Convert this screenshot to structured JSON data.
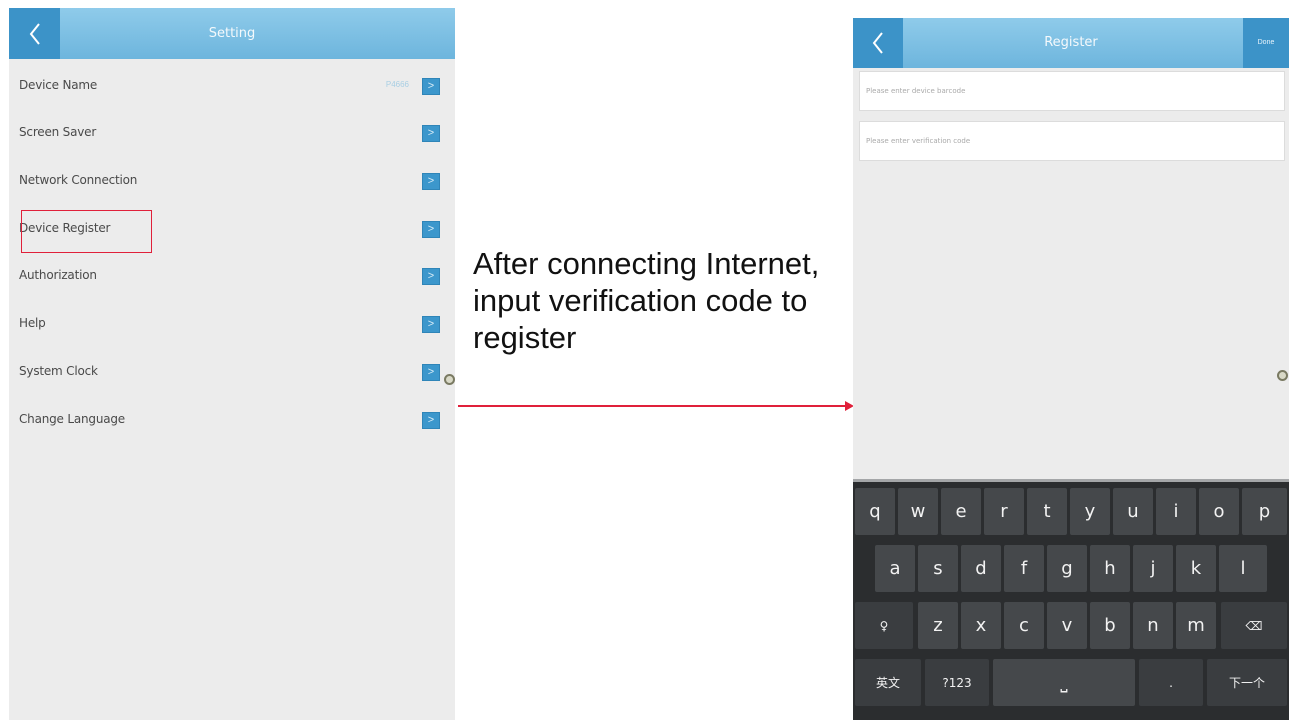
{
  "setting_screen": {
    "title": "Setting",
    "items": [
      {
        "label": "Device Name",
        "value": "P4666"
      },
      {
        "label": "Screen Saver",
        "value": ""
      },
      {
        "label": "Network Connection",
        "value": ""
      },
      {
        "label": "Device Register",
        "value": ""
      },
      {
        "label": "Authorization",
        "value": ""
      },
      {
        "label": "Help",
        "value": ""
      },
      {
        "label": "System Clock",
        "value": ""
      },
      {
        "label": "Change Language",
        "value": ""
      }
    ],
    "arrow_glyph": ">",
    "highlighted_item": "Device Register"
  },
  "annotation": {
    "text": "After connecting Internet, input verification code to register",
    "arrow_color": "#e0203a"
  },
  "register_screen": {
    "title": "Register",
    "done_label": "Done",
    "barcode_placeholder": "Please enter device barcode",
    "verification_placeholder": "Please enter verification code"
  },
  "keyboard": {
    "row1": [
      "q",
      "w",
      "e",
      "r",
      "t",
      "y",
      "u",
      "i",
      "o",
      "p"
    ],
    "row2": [
      "a",
      "s",
      "d",
      "f",
      "g",
      "h",
      "j",
      "k",
      "l"
    ],
    "row3": [
      "z",
      "x",
      "c",
      "v",
      "b",
      "n",
      "m"
    ],
    "mic_key": "♀",
    "delete_key": "⌫",
    "lang_key": "英文",
    "num_key": "?123",
    "space_key": "⎵",
    "period_key": ".",
    "next_key": "下一个"
  },
  "colors": {
    "titlebar": "#6db5dd",
    "accent": "#3c93c8",
    "highlight": "#e0203a",
    "keyboard_bg": "#2b2d2f"
  }
}
